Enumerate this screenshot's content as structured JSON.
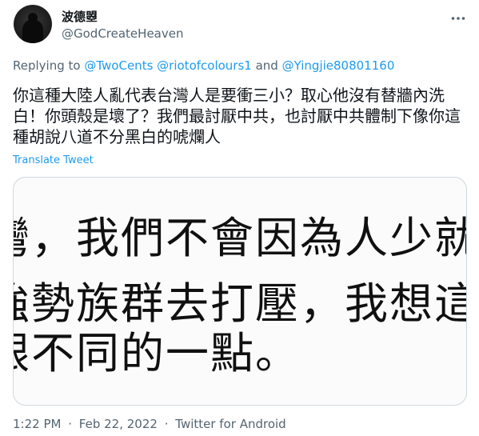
{
  "author": {
    "display_name": "波德曌",
    "handle": "@GodCreateHeaven"
  },
  "reply": {
    "prefix": "Replying to",
    "mentions": [
      "@TwoCents",
      "@riotofcolours1",
      "@Yingjie80801160"
    ],
    "connector": "and"
  },
  "tweet": {
    "text": "你這種大陸人亂代表台灣人是要衝三小？取心他沒有替牆內洗白！你頭殼是壞了？我們最討厭中共，也討厭中共體制下像你這種胡說八道不分黑白的唬爛人",
    "translate_label": "Translate Tweet"
  },
  "media": {
    "lines": [
      "灣，我們不會因為人少就",
      "強勢族群去打壓，我想這",
      "跟不同的一點。"
    ]
  },
  "meta": {
    "time": "1:22 PM",
    "separator": "·",
    "date": "Feb 22, 2022",
    "source": "Twitter for Android"
  },
  "icons": {
    "more": "more-dots-icon",
    "avatar": "avatar-image"
  },
  "colors": {
    "link": "#1d9bf0",
    "secondary_text": "#536471",
    "primary_text": "#0f1419",
    "border": "#cfd9de"
  }
}
